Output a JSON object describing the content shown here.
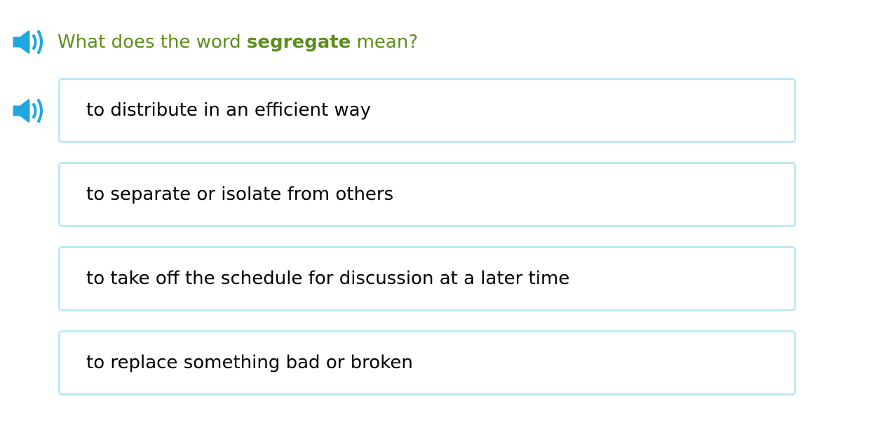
{
  "question": {
    "prefix": "What does the word",
    "word": "segregate",
    "suffix": "mean?"
  },
  "choices": [
    {
      "label": "to distribute in an efficient way",
      "has_audio": true
    },
    {
      "label": "to separate or isolate from others",
      "has_audio": false
    },
    {
      "label": "to take off the schedule for discussion at a later time",
      "has_audio": false
    },
    {
      "label": "to replace something bad or broken",
      "has_audio": false
    }
  ],
  "icons": {
    "question_audio": "speaker-icon",
    "choice_audio": "speaker-icon"
  },
  "colors": {
    "question_text": "#5f8c1d",
    "speaker": "#1ea7e0",
    "choice_border": "#bfe8f7",
    "choice_text": "#000000"
  }
}
